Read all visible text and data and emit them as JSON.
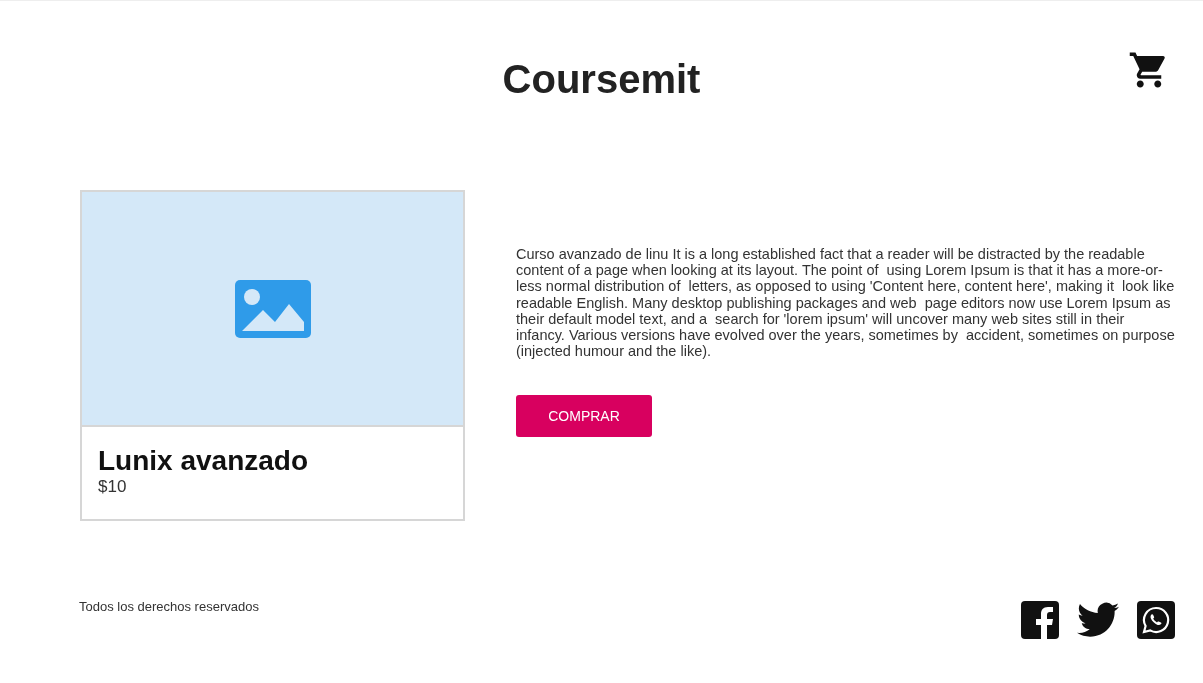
{
  "header": {
    "title": "Coursemit"
  },
  "course": {
    "name": "Lunix avanzado",
    "price": "$10",
    "description": "Curso avanzado de linu It is a long established fact that a reader will be distracted by the readable content of a page when looking at its layout. The point of  using Lorem Ipsum is that it has a more-or-less normal distribution of  letters, as opposed to using 'Content here, content here', making it  look like readable English. Many desktop publishing packages and web  page editors now use Lorem Ipsum as their default model text, and a  search for 'lorem ipsum' will uncover many web sites still in their  infancy. Various versions have evolved over the years, sometimes by  accident, sometimes on purpose (injected humour and the like).",
    "button": "COMPRAR"
  },
  "footer": {
    "copyright": "Todos los derechos reservados"
  }
}
